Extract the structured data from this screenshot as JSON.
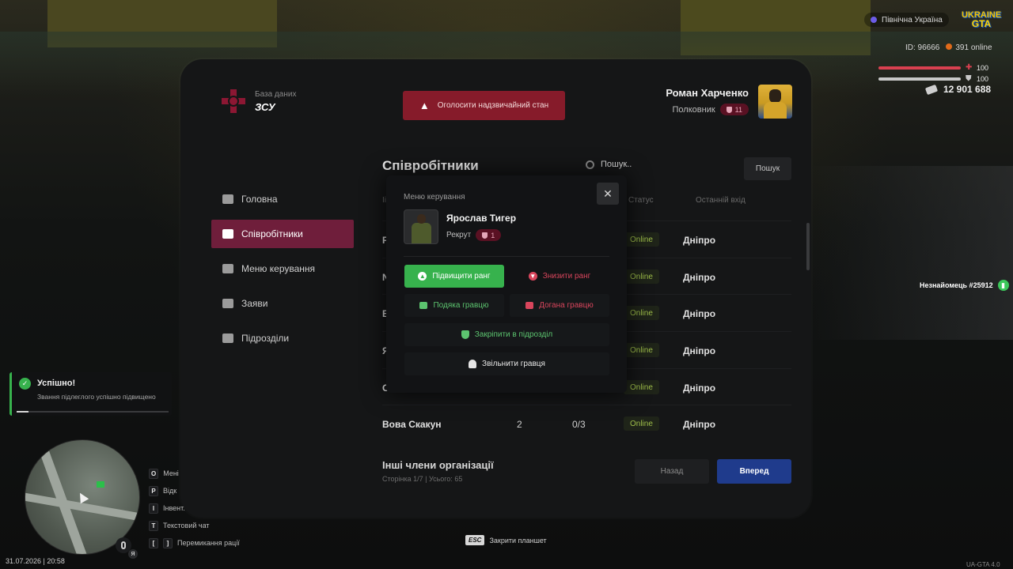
{
  "hud": {
    "server": "Північна Україна",
    "logo_top": "UKRAINE",
    "logo_bottom": "GTA",
    "id_text": "ID: 96666",
    "online_text": "391 online",
    "health": "100",
    "armor": "100",
    "health_fraction": 1.0,
    "armor_fraction": 1.0,
    "money": "12 901 688",
    "npc_tag": "Незнайомець #25912"
  },
  "header": {
    "db_label": "База даних",
    "org_name": "ЗСУ",
    "alarm_label": "Оголосити надзвичайний стан",
    "user_name": "Роман Харченко",
    "user_rank": "Полковник",
    "user_rank_level": "11"
  },
  "nav": {
    "items": [
      {
        "label": "Головна",
        "icon": "home-icon"
      },
      {
        "label": "Співробітники",
        "icon": "people-icon"
      },
      {
        "label": "Меню керування",
        "icon": "gear-icon"
      },
      {
        "label": "Заяви",
        "icon": "folder-icon"
      },
      {
        "label": "Підрозділи",
        "icon": "shield-icon"
      }
    ],
    "active_index": 1
  },
  "employees": {
    "title": "Співробітники",
    "search_placeholder": "Пошук..",
    "search_button": "Пошук",
    "columns": {
      "id": "Іі",
      "status": "Статус",
      "last_login": "Останній вхід"
    },
    "rows": [
      {
        "name": "Р",
        "rank": "",
        "warns": "",
        "status": "Online",
        "city": "Дніпро"
      },
      {
        "name": "N",
        "rank": "",
        "warns": "",
        "status": "Online",
        "city": "Дніпро"
      },
      {
        "name": "В",
        "rank": "",
        "warns": "",
        "status": "Online",
        "city": "Дніпро"
      },
      {
        "name": "Я",
        "rank": "",
        "warns": "",
        "status": "Online",
        "city": "Дніпро"
      },
      {
        "name": "О",
        "rank": "",
        "warns": "",
        "status": "Online",
        "city": "Дніпро"
      },
      {
        "name": "Вова Скакун",
        "rank": "2",
        "warns": "0/3",
        "status": "Online",
        "city": "Дніпро"
      }
    ],
    "other_members": "Інші члени організації",
    "page_info": "Сторінка 1/7 | Усього: 65",
    "back_button": "Назад",
    "next_button": "Вперед"
  },
  "modal": {
    "title": "Меню керування",
    "user_name": "Ярослав Тигер",
    "user_rank": "Рекрут",
    "user_rank_level": "1",
    "promote": "Підвищити ранг",
    "demote": "Знизити ранг",
    "thanks": "Подяка гравцю",
    "reprimand": "Догана гравцю",
    "assign": "Закріпити в підрозділ",
    "fire": "Звільнити гравця"
  },
  "notification": {
    "title": "Успішно!",
    "text": "Звання підлеглого успішно підвищено",
    "progress": 0.08
  },
  "keys": [
    {
      "key": "O",
      "label": "Мені"
    },
    {
      "key": "P",
      "label": "Відк"
    },
    {
      "key": "I",
      "label": "Інвент."
    },
    {
      "key": "T",
      "label": "Текстовий чат"
    },
    {
      "key_a": "[",
      "key_b": "]",
      "label": "Перемикання рації"
    }
  ],
  "footer": {
    "datetime": "31.07.2026 | 20:58",
    "esc_key": "ESC",
    "esc_label": "Закрити планшет",
    "version": "UA-GTA 4.0",
    "mic_lang": "Я"
  },
  "colors": {
    "accent_nav": "#6f1e3b",
    "alarm": "#861b2a",
    "promote": "#37b24d",
    "danger": "#d9455c",
    "next": "#1f3b8c"
  }
}
